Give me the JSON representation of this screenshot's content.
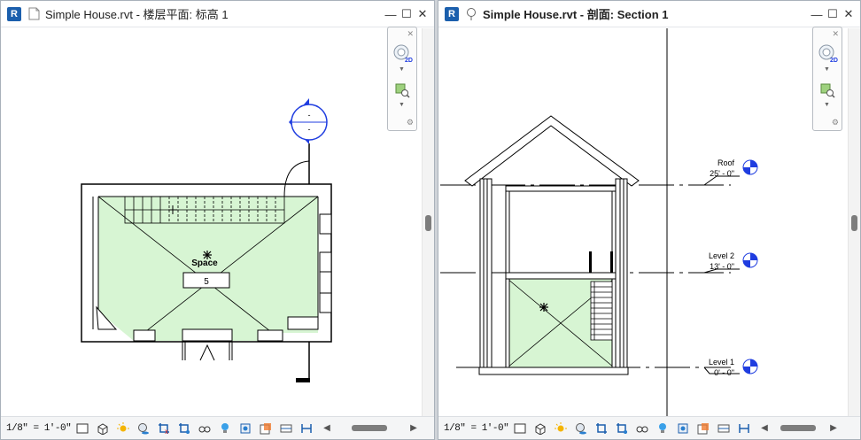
{
  "left_window": {
    "app_letter": "R",
    "title": "Simple House.rvt - 楼层平面: 标高 1",
    "scale": "1/8\" = 1'-0\"",
    "room_name": "Space",
    "room_number": "5",
    "section_head_label": "-",
    "section_tail_label": "-"
  },
  "right_window": {
    "app_letter": "R",
    "title": "Simple House.rvt - 剖面: Section 1",
    "scale": "1/8\" = 1'-0\"",
    "levels": [
      {
        "name": "Roof",
        "elevation": "25' - 0\""
      },
      {
        "name": "Level 2",
        "elevation": "13' - 0\""
      },
      {
        "name": "Level 1",
        "elevation": "0' - 0\""
      }
    ]
  },
  "window_buttons": {
    "minimize": "—",
    "restore": "☐",
    "close": "✕"
  },
  "nav_bar": {
    "wheel_label": "2D"
  },
  "colors": {
    "room_fill": "#d7f5d3",
    "accent_blue": "#1f3de0",
    "revit_blue": "#1b5fad",
    "thumb": "#7d7d7d"
  },
  "status_icons": [
    "detail-level-icon",
    "visual-style-icon",
    "sun-path-icon",
    "shadows-icon",
    "crop-view-icon",
    "show-crop-region-icon",
    "unlock-3d-view-icon",
    "temporary-hide-icon",
    "reveal-hidden-icon",
    "worksharing-display-icon",
    "analytical-model-icon",
    "highlight-displacement-icon",
    "constraints-icon"
  ]
}
